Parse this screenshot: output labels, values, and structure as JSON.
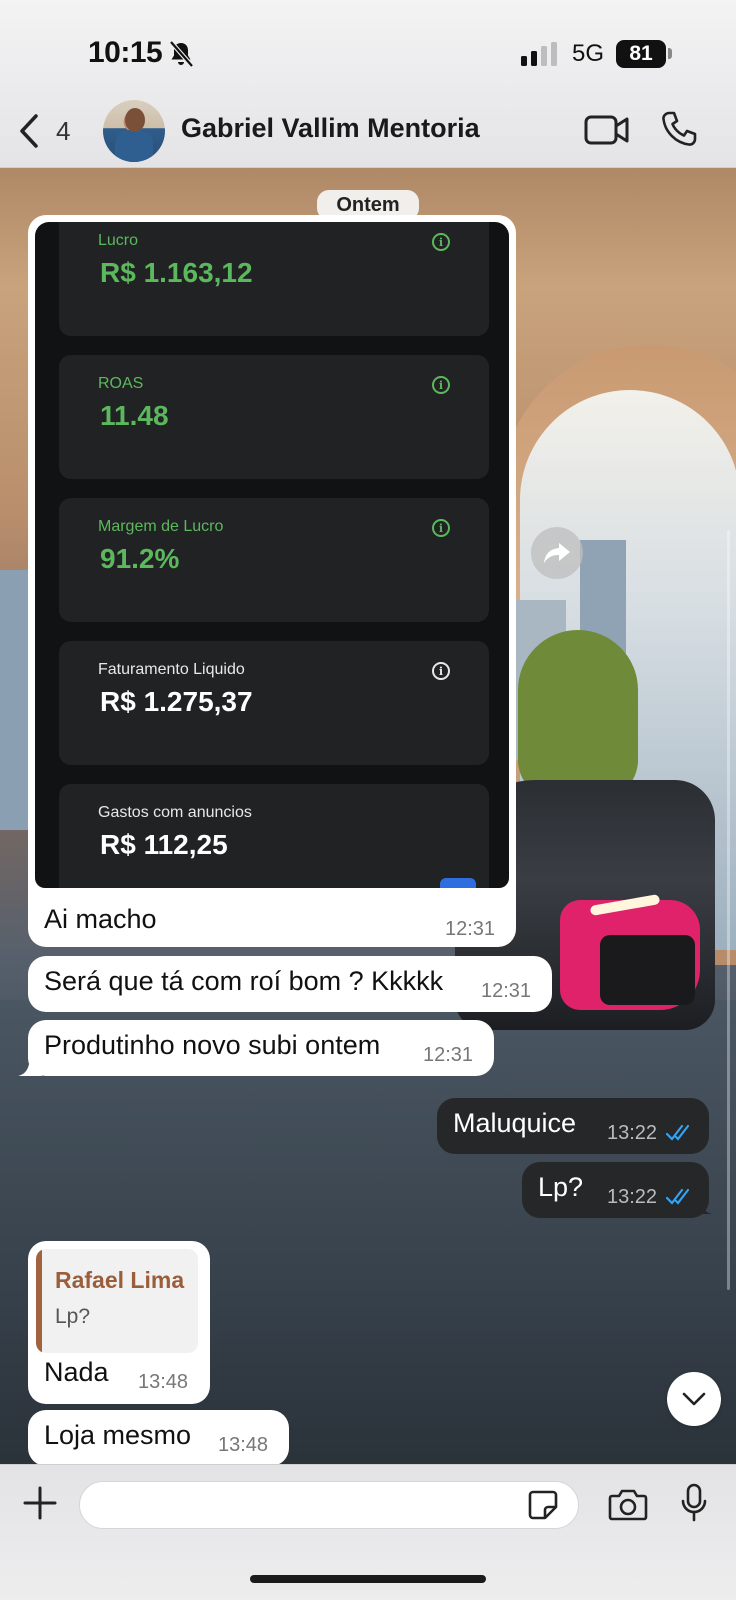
{
  "status_bar": {
    "time": "10:15",
    "network": "5G",
    "battery": "81"
  },
  "header": {
    "back_count": "4",
    "contact_name": "Gabriel Vallim Mentoria"
  },
  "chat": {
    "date_separator": "Ontem",
    "image_message": {
      "metrics": [
        {
          "label": "Lucro",
          "value": "R$ 1.163,12",
          "color": "#5cb85c"
        },
        {
          "label": "ROAS",
          "value": "11.48",
          "color": "#5cb85c"
        },
        {
          "label": "Margem de Lucro",
          "value": "91.2%",
          "color": "#5cb85c"
        },
        {
          "label": "Faturamento Liquido",
          "value": "R$ 1.275,37",
          "color": "#ffffff"
        },
        {
          "label": "Gastos com anuncios",
          "value": "R$ 112,25",
          "color": "#ffffff"
        }
      ],
      "caption": "Ai macho",
      "time": "12:31"
    },
    "messages": [
      {
        "direction": "in",
        "text": "Será que tá com roí bom ? Kkkkk",
        "time": "12:31"
      },
      {
        "direction": "in",
        "text": "Produtinho novo subi ontem",
        "time": "12:31"
      },
      {
        "direction": "out",
        "text": "Maluquice",
        "time": "13:22",
        "status": "read"
      },
      {
        "direction": "out",
        "text": "Lp?",
        "time": "13:22",
        "status": "read"
      },
      {
        "direction": "in",
        "reply_to": {
          "author": "Rafael Lima",
          "text": "Lp?"
        },
        "text": "Nada",
        "time": "13:48"
      },
      {
        "direction": "in",
        "text": "Loja mesmo",
        "time": "13:48"
      }
    ]
  },
  "composer": {
    "placeholder": ""
  },
  "colors": {
    "read_tick": "#34a3f0",
    "metric_green": "#5cb85c",
    "outgoing_bubble": "#262729",
    "reply_author": "#9b5e3a"
  }
}
